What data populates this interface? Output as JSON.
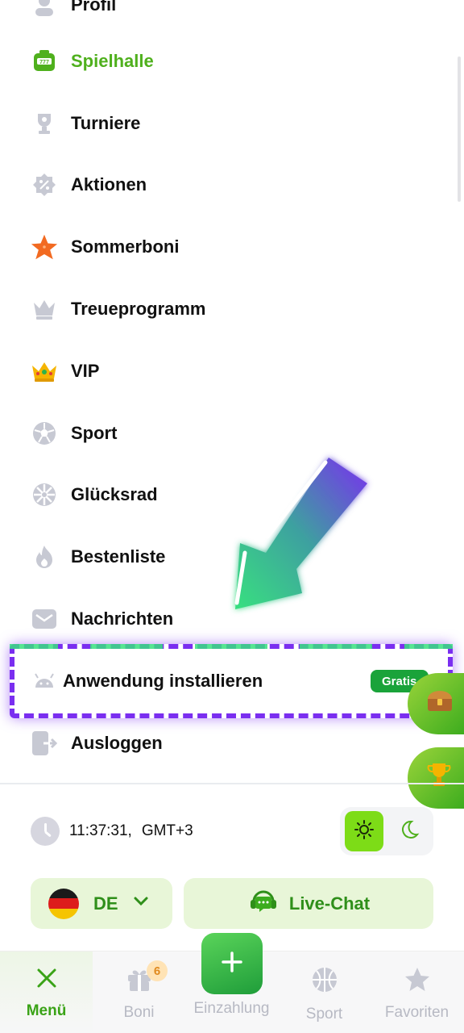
{
  "menu": {
    "items": [
      {
        "label": "Profil",
        "icon": "profile-icon"
      },
      {
        "label": "Spielhalle",
        "icon": "slot-machine-icon",
        "active": true
      },
      {
        "label": "Turniere",
        "icon": "trophy-icon"
      },
      {
        "label": "Aktionen",
        "icon": "percent-badge-icon"
      },
      {
        "label": "Sommerboni",
        "icon": "starfish-icon"
      },
      {
        "label": "Treueprogramm",
        "icon": "crown-icon"
      },
      {
        "label": "VIP",
        "icon": "vip-crown-icon"
      },
      {
        "label": "Sport",
        "icon": "soccer-ball-icon"
      },
      {
        "label": "Glücksrad",
        "icon": "wheel-icon"
      },
      {
        "label": "Bestenliste",
        "icon": "flame-icon"
      },
      {
        "label": "Nachrichten",
        "icon": "envelope-icon"
      },
      {
        "label": "Anwendung installieren",
        "icon": "android-icon",
        "badge": "Gratis"
      },
      {
        "label": "Ausloggen",
        "icon": "logout-icon"
      }
    ]
  },
  "clock": {
    "time": "11:37:31,",
    "timezone": "GMT+3"
  },
  "theme": {
    "options": [
      "light",
      "dark"
    ],
    "selected": "light"
  },
  "language": {
    "code": "DE"
  },
  "chat": {
    "label": "Live-Chat"
  },
  "bottom_nav": {
    "items": [
      {
        "label": "Menü",
        "active": true
      },
      {
        "label": "Boni",
        "badge": "6"
      },
      {
        "label": "Einzahlung"
      },
      {
        "label": "Sport"
      },
      {
        "label": "Favoriten"
      }
    ]
  },
  "colors": {
    "accent": "#4fb01d",
    "highlight": "#7a2ef0",
    "arrow_start": "#38e07f",
    "arrow_end": "#7a2ef0"
  }
}
